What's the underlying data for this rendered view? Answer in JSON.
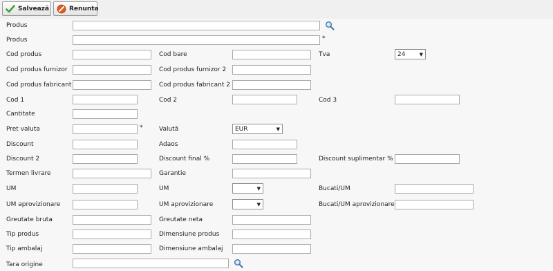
{
  "toolbar": {
    "save_label": "Salvează",
    "cancel_label": "Renunta"
  },
  "colors": {
    "save_icon": "#3aa23a",
    "cancel_icon": "#e25a1c"
  },
  "required_mark": "*",
  "labels": {
    "produs_search": "Produs",
    "produs": "Produs",
    "cod_produs": "Cod produs",
    "cod_bare": "Cod bare",
    "tva": "Tva",
    "cod_produs_furnizor": "Cod produs furnizor",
    "cod_produs_furnizor_2": "Cod produs furnizor 2",
    "cod_produs_fabricant": "Cod produs fabricant",
    "cod_produs_fabricant_2": "Cod produs fabricant 2",
    "cod_1": "Cod 1",
    "cod_2": "Cod 2",
    "cod_3": "Cod 3",
    "cantitate": "Cantitate",
    "pret_valuta": "Pret valuta",
    "valuta": "Valută",
    "discount": "Discount",
    "adaos": "Adaos",
    "discount_2": "Discount 2",
    "discount_final": "Discount final %",
    "discount_suplimentar": "Discount suplimentar %",
    "termen_livrare": "Termen livrare",
    "garantie": "Garantie",
    "um": "UM",
    "um_2": "UM",
    "bucati_um": "Bucati/UM",
    "um_aprovizionare": "UM aprovizionare",
    "um_aprovizionare_2": "UM aprovizionare",
    "bucati_um_aprovizionare": "Bucati/UM aprovizionare",
    "greutate_bruta": "Greutate bruta",
    "greutate_neta": "Greutate neta",
    "tip_produs": "Tip produs",
    "dimensiune_produs": "Dimensiune produs",
    "tip_ambalaj": "Tip ambalaj",
    "dimensiune_ambalaj": "Dimensiune ambalaj",
    "tara_origine": "Tara origine"
  },
  "selects": {
    "tva": "24",
    "valuta": "EUR",
    "um": "",
    "um_aprovizionare": ""
  },
  "values": {
    "produs_search": "",
    "produs": "",
    "cod_produs": "",
    "cod_bare": "",
    "cod_produs_furnizor": "",
    "cod_produs_furnizor_2": "",
    "cod_produs_fabricant": "",
    "cod_produs_fabricant_2": "",
    "cod_1": "",
    "cod_2": "",
    "cod_3": "",
    "cantitate": "",
    "pret_valuta": "",
    "discount": "",
    "adaos": "",
    "discount_2": "",
    "discount_final": "",
    "discount_suplimentar": "",
    "termen_livrare": "",
    "garantie": "",
    "bucati_um": "",
    "bucati_um_aprovizionare": "",
    "greutate_bruta": "",
    "greutate_neta": "",
    "tip_produs": "",
    "dimensiune_produs": "",
    "tip_ambalaj": "",
    "dimensiune_ambalaj": "",
    "tara_origine": ""
  }
}
